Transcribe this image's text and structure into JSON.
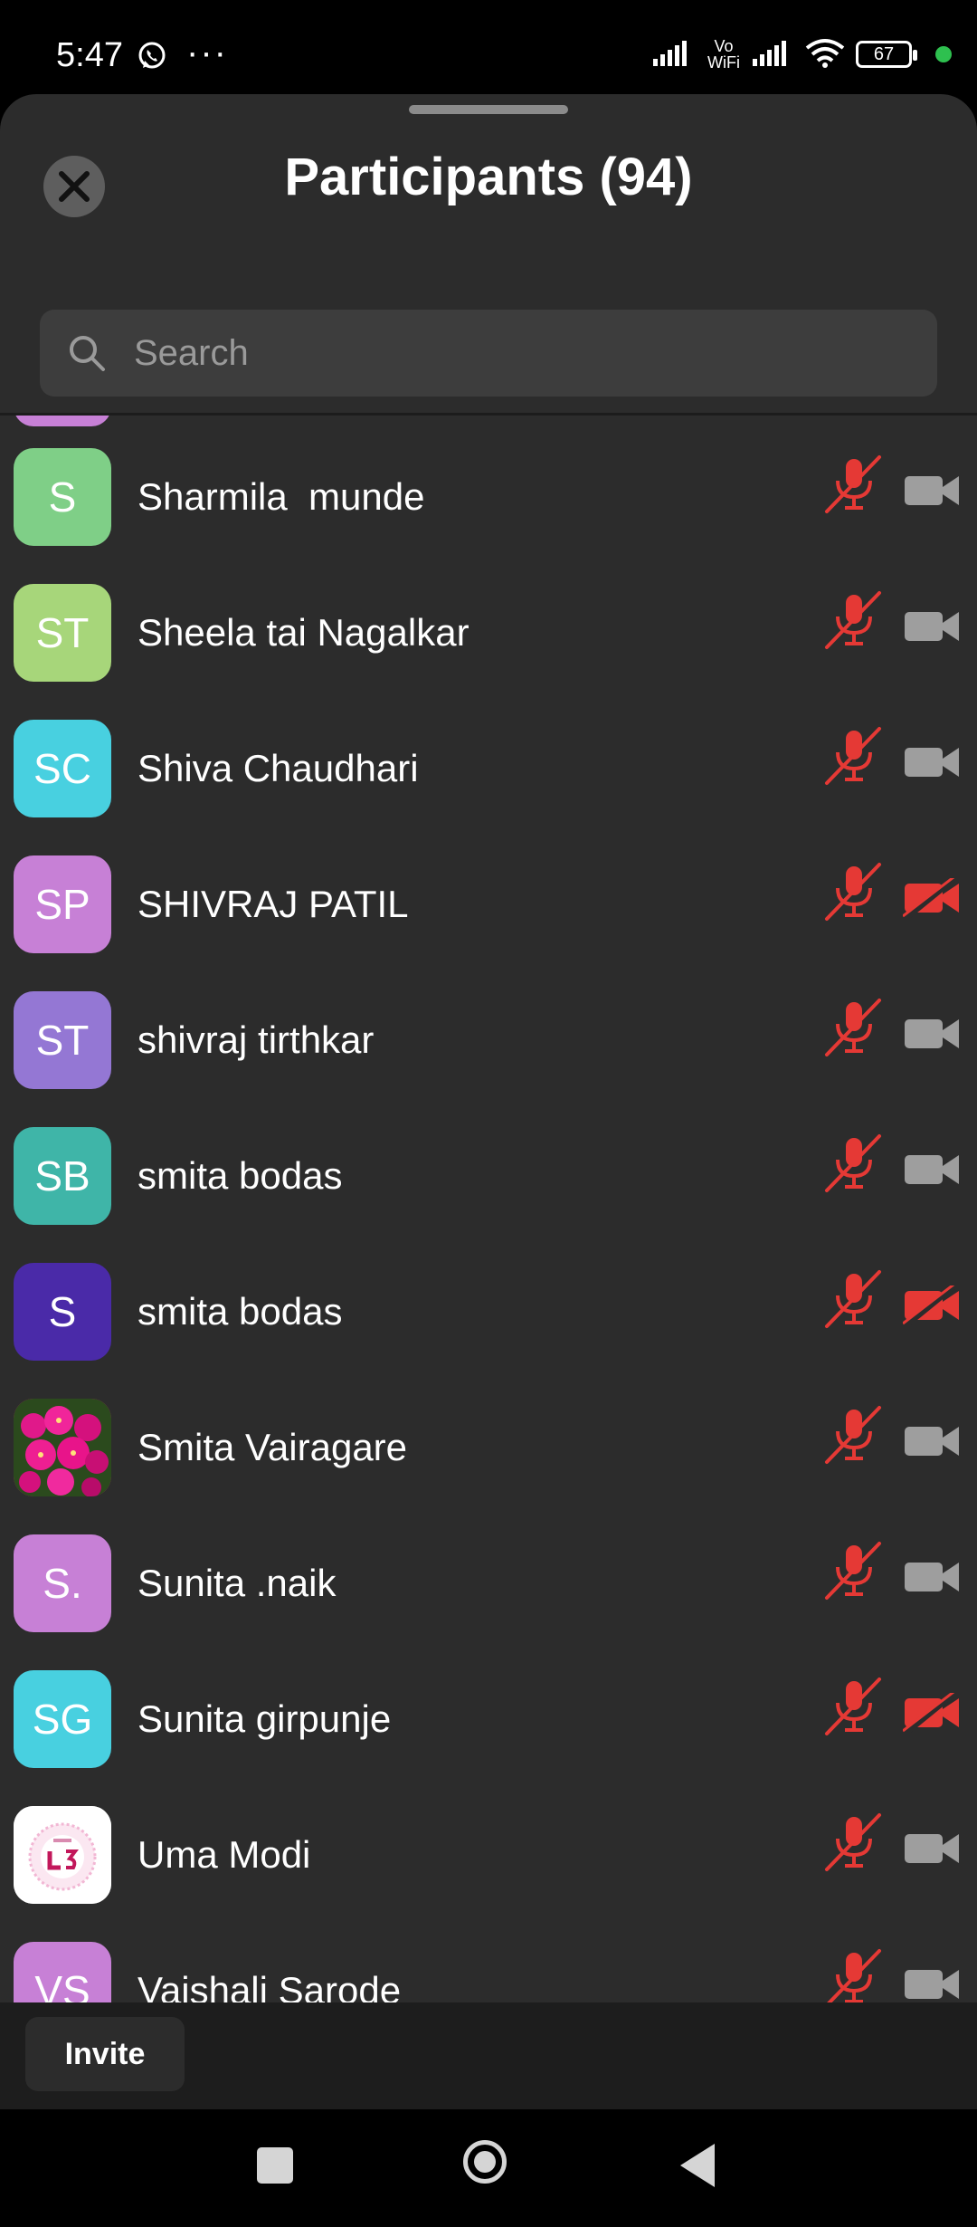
{
  "status_bar": {
    "time": "5:47",
    "dots": "···",
    "vo": "Vo",
    "wifi_label": "WiFi",
    "battery": "67",
    "icons": [
      "whatsapp-icon",
      "signal-icon",
      "wifi-icon",
      "battery-icon"
    ]
  },
  "header": {
    "title": "Participants (94)",
    "close_icon": "close-icon"
  },
  "search": {
    "placeholder": "Search",
    "icon": "search-icon"
  },
  "participants": [
    {
      "initials": "S",
      "name": "Sharmila  munde",
      "avatar_color": "#7fcf87",
      "mic_muted": true,
      "video_off": false
    },
    {
      "initials": "ST",
      "name": "Sheela tai Nagalkar",
      "avatar_color": "#a7d67a",
      "mic_muted": true,
      "video_off": false
    },
    {
      "initials": "SC",
      "name": "Shiva Chaudhari",
      "avatar_color": "#48d0e0",
      "mic_muted": true,
      "video_off": false
    },
    {
      "initials": "SP",
      "name": "SHIVRAJ PATIL",
      "avatar_color": "#c780d6",
      "mic_muted": true,
      "video_off": true
    },
    {
      "initials": "ST",
      "name": "shivraj tirthkar",
      "avatar_color": "#9477d4",
      "mic_muted": true,
      "video_off": false
    },
    {
      "initials": "SB",
      "name": "smita bodas",
      "avatar_color": "#3fb5a8",
      "mic_muted": true,
      "video_off": false
    },
    {
      "initials": "S",
      "name": "smita bodas",
      "avatar_color": "#4a2aa8",
      "mic_muted": true,
      "video_off": true
    },
    {
      "initials": "",
      "name": "Smita Vairagare",
      "avatar_color": "#d1177a",
      "avatar_image": "flowers-photo",
      "mic_muted": true,
      "video_off": false
    },
    {
      "initials": "S.",
      "name": "Sunita .naik",
      "avatar_color": "#c780d6",
      "mic_muted": true,
      "video_off": false
    },
    {
      "initials": "SG",
      "name": "Sunita girpunje",
      "avatar_color": "#48d0e0",
      "mic_muted": true,
      "video_off": true
    },
    {
      "initials": "",
      "name": "Uma Modi",
      "avatar_color": "#ffffff",
      "avatar_image": "l3-logo",
      "mic_muted": true,
      "video_off": false
    },
    {
      "initials": "VS",
      "name": "Vaishali Sarode",
      "avatar_color": "#c780d6",
      "mic_muted": true,
      "video_off": false
    }
  ],
  "bottom": {
    "invite_label": "Invite"
  },
  "colors": {
    "muted": "#e53935",
    "camera_on": "#9e9e9e",
    "sheet_bg": "#2c2c2c"
  }
}
